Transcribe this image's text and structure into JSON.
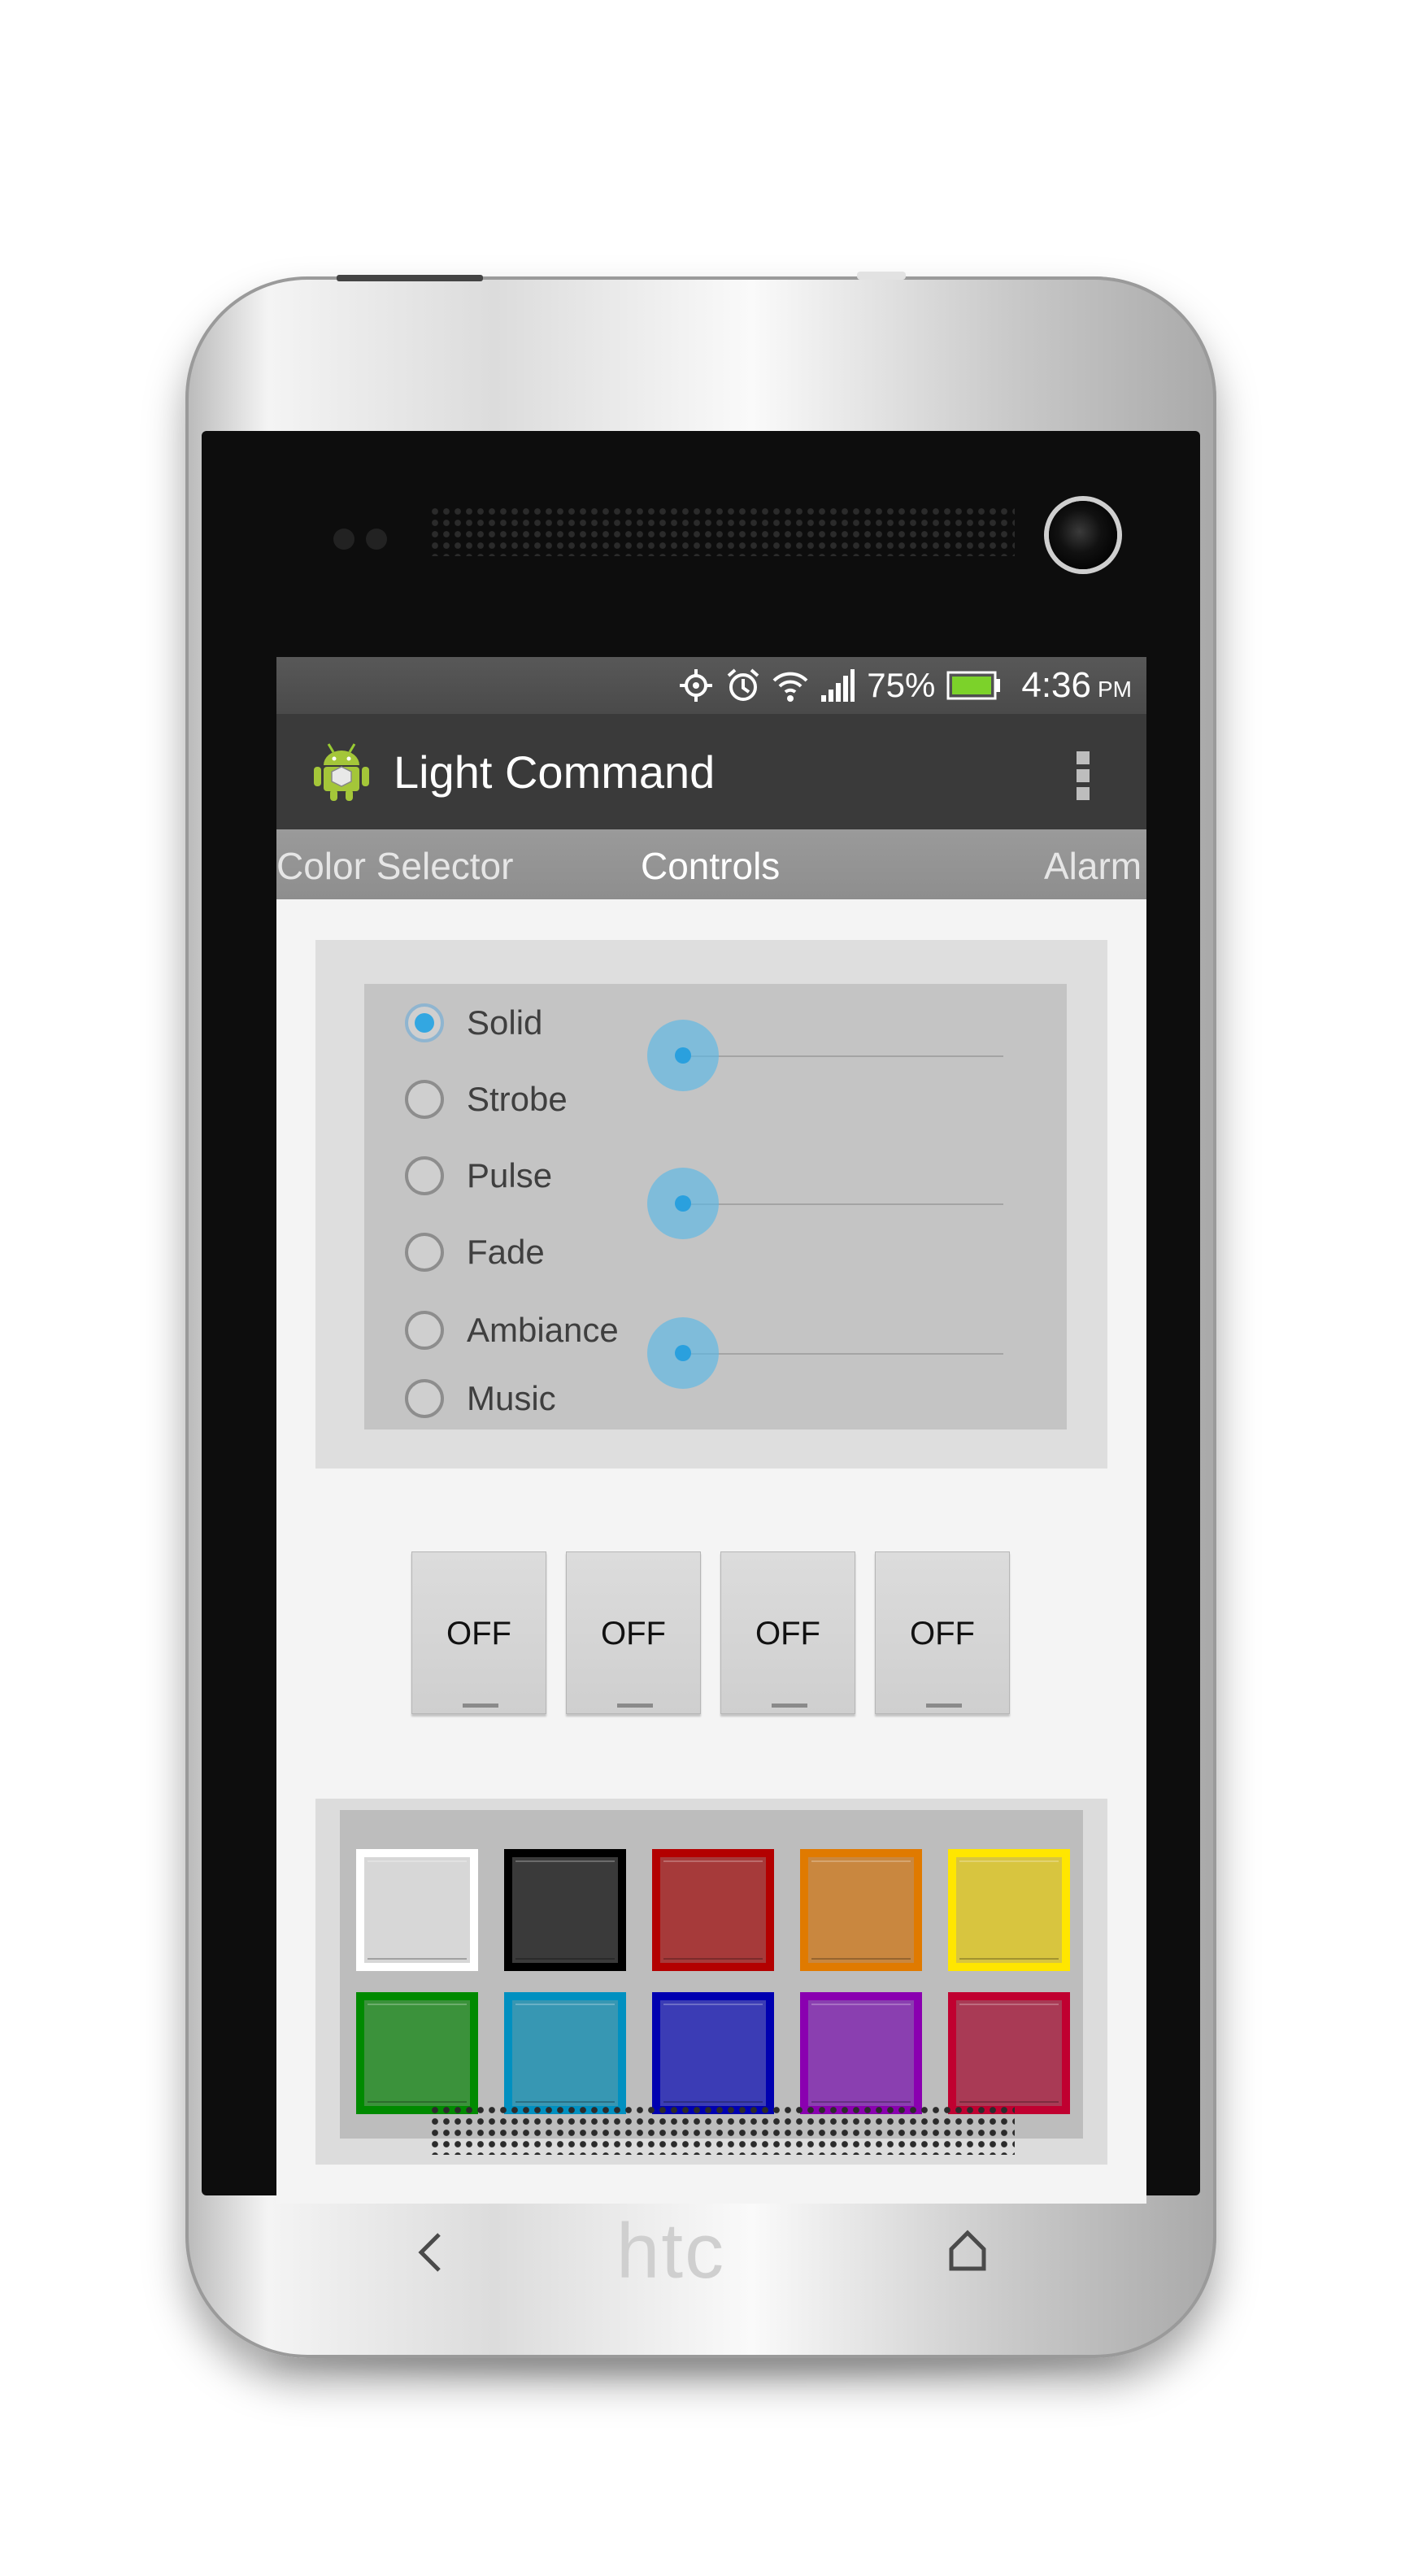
{
  "status_bar": {
    "icons": [
      "gps-icon",
      "alarm-icon",
      "wifi-icon",
      "signal-icon",
      "battery-icon"
    ],
    "battery_percent": "75%",
    "time": "4:36",
    "ampm": "PM"
  },
  "action_bar": {
    "app_icon": "android-icon",
    "title": "Light Command",
    "overflow_icon": "overflow-menu-icon"
  },
  "tabs": [
    {
      "label": "Color Selector",
      "active": false
    },
    {
      "label": "Controls",
      "active": true
    },
    {
      "label": "Alarm",
      "active": false
    }
  ],
  "modes": {
    "options": [
      "Solid",
      "Strobe",
      "Pulse",
      "Fade",
      "Ambiance",
      "Music"
    ],
    "selected": "Solid"
  },
  "sliders": [
    {
      "value": 0
    },
    {
      "value": 0
    },
    {
      "value": 0
    }
  ],
  "switches": [
    {
      "label": "OFF"
    },
    {
      "label": "OFF"
    },
    {
      "label": "OFF"
    },
    {
      "label": "OFF"
    }
  ],
  "colors": [
    {
      "border": "#ffffff",
      "fill": "#d7d7d7"
    },
    {
      "border": "#000000",
      "fill": "#3a3a3a"
    },
    {
      "border": "#b30000",
      "fill": "#a63a3a"
    },
    {
      "border": "#e07a00",
      "fill": "#c9873f"
    },
    {
      "border": "#ffe600",
      "fill": "#d8c53f"
    },
    {
      "border": "#008a00",
      "fill": "#3b923b"
    },
    {
      "border": "#0090c0",
      "fill": "#3797b3"
    },
    {
      "border": "#0000b0",
      "fill": "#3b3cb5"
    },
    {
      "border": "#8a00b0",
      "fill": "#8a3fb0"
    },
    {
      "border": "#c00030",
      "fill": "#a93a55"
    }
  ],
  "device": {
    "brand": "htc",
    "nav": [
      "back-icon",
      "home-icon"
    ]
  }
}
